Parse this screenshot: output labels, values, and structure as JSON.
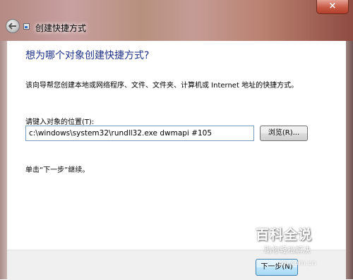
{
  "window": {
    "title": "创建快捷方式",
    "close_label": "×"
  },
  "wizard": {
    "heading": "想为哪个对象创建快捷方式?",
    "description": "该向导帮您创建本地或网络程序、文件、文件夹、计算机或 Internet 地址的快捷方式。",
    "location_label": "请键入对象的位置(T):",
    "location_value": "c:\\windows\\system32\\rundll32.exe dwmapi #105",
    "browse_label": "浏览(R)...",
    "hint": "单击“下一步”继续。"
  },
  "footer": {
    "next_label": "下一步(N)"
  },
  "watermark": {
    "title": "百科全说",
    "subtitle": "助你轻松解决",
    "site": "zol.com.cn"
  },
  "icons": {
    "back": "back-arrow-icon",
    "wizard": "shortcut-wizard-icon"
  }
}
